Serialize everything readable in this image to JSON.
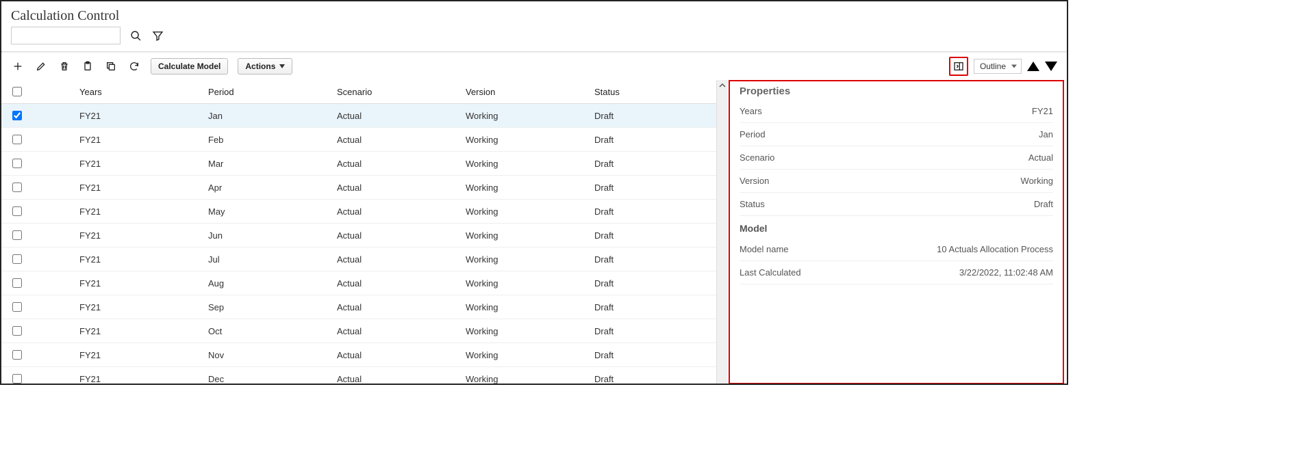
{
  "title": "Calculation Control",
  "toolbar": {
    "calculate_label": "Calculate Model",
    "actions_label": "Actions",
    "view_selector": "Outline"
  },
  "columns": [
    "Years",
    "Period",
    "Scenario",
    "Version",
    "Status"
  ],
  "rows": [
    {
      "selected": true,
      "years": "FY21",
      "period": "Jan",
      "scenario": "Actual",
      "version": "Working",
      "status": "Draft"
    },
    {
      "selected": false,
      "years": "FY21",
      "period": "Feb",
      "scenario": "Actual",
      "version": "Working",
      "status": "Draft"
    },
    {
      "selected": false,
      "years": "FY21",
      "period": "Mar",
      "scenario": "Actual",
      "version": "Working",
      "status": "Draft"
    },
    {
      "selected": false,
      "years": "FY21",
      "period": "Apr",
      "scenario": "Actual",
      "version": "Working",
      "status": "Draft"
    },
    {
      "selected": false,
      "years": "FY21",
      "period": "May",
      "scenario": "Actual",
      "version": "Working",
      "status": "Draft"
    },
    {
      "selected": false,
      "years": "FY21",
      "period": "Jun",
      "scenario": "Actual",
      "version": "Working",
      "status": "Draft"
    },
    {
      "selected": false,
      "years": "FY21",
      "period": "Jul",
      "scenario": "Actual",
      "version": "Working",
      "status": "Draft"
    },
    {
      "selected": false,
      "years": "FY21",
      "period": "Aug",
      "scenario": "Actual",
      "version": "Working",
      "status": "Draft"
    },
    {
      "selected": false,
      "years": "FY21",
      "period": "Sep",
      "scenario": "Actual",
      "version": "Working",
      "status": "Draft"
    },
    {
      "selected": false,
      "years": "FY21",
      "period": "Oct",
      "scenario": "Actual",
      "version": "Working",
      "status": "Draft"
    },
    {
      "selected": false,
      "years": "FY21",
      "period": "Nov",
      "scenario": "Actual",
      "version": "Working",
      "status": "Draft"
    },
    {
      "selected": false,
      "years": "FY21",
      "period": "Dec",
      "scenario": "Actual",
      "version": "Working",
      "status": "Draft"
    }
  ],
  "panel": {
    "title": "Properties",
    "props": {
      "years_label": "Years",
      "years_value": "FY21",
      "period_label": "Period",
      "period_value": "Jan",
      "scenario_label": "Scenario",
      "scenario_value": "Actual",
      "version_label": "Version",
      "version_value": "Working",
      "status_label": "Status",
      "status_value": "Draft"
    },
    "model_heading": "Model",
    "model": {
      "name_label": "Model name",
      "name_value": "10 Actuals Allocation Process",
      "last_label": "Last Calculated",
      "last_value": "3/22/2022, 11:02:48 AM"
    }
  }
}
